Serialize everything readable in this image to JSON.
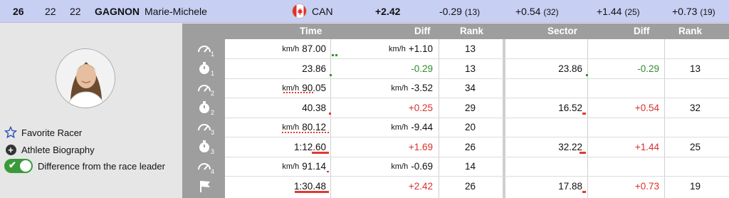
{
  "header": {
    "rank": "26",
    "num1": "22",
    "num2": "22",
    "last_name": "GAGNON",
    "first_name": "Marie-Michele",
    "nation": "CAN",
    "total_diff": "+2.42",
    "splits": [
      {
        "diff": "-0.29",
        "rank": "(13)"
      },
      {
        "diff": "+0.54",
        "rank": "(32)"
      },
      {
        "diff": "+1.44",
        "rank": "(25)"
      },
      {
        "diff": "+0.73",
        "rank": "(19)"
      }
    ]
  },
  "options": {
    "favorite": "Favorite Racer",
    "biography": "Athlete Biography",
    "difference": "Difference from the race leader",
    "difference_on": true
  },
  "columns": {
    "time": "Time",
    "diff": "Diff",
    "rank": "Rank",
    "sector": "Sector",
    "sector_diff": "Diff",
    "sector_rank": "Rank"
  },
  "rows": [
    {
      "icon": "speed-1-icon",
      "unit": "km/h",
      "time": "87.00",
      "diff_unit": "km/h",
      "diff": "+1.10",
      "rank": "13",
      "sector": "",
      "sector_diff": "",
      "sector_rank": ""
    },
    {
      "icon": "stopwatch-1-icon",
      "unit": "",
      "time": "23.86",
      "diff_unit": "",
      "diff": "-0.29",
      "rank": "13",
      "sector": "23.86",
      "sector_diff": "-0.29",
      "sector_rank": "13"
    },
    {
      "icon": "speed-2-icon",
      "unit": "km/h",
      "time": "90.05",
      "diff_unit": "km/h",
      "diff": "-3.52",
      "rank": "34",
      "sector": "",
      "sector_diff": "",
      "sector_rank": ""
    },
    {
      "icon": "stopwatch-2-icon",
      "unit": "",
      "time": "40.38",
      "diff_unit": "",
      "diff": "+0.25",
      "rank": "29",
      "sector": "16.52",
      "sector_diff": "+0.54",
      "sector_rank": "32"
    },
    {
      "icon": "speed-3-icon",
      "unit": "km/h",
      "time": "80.12",
      "diff_unit": "km/h",
      "diff": "-9.44",
      "rank": "20",
      "sector": "",
      "sector_diff": "",
      "sector_rank": ""
    },
    {
      "icon": "stopwatch-3-icon",
      "unit": "",
      "time": "1:12.60",
      "diff_unit": "",
      "diff": "+1.69",
      "rank": "26",
      "sector": "32.22",
      "sector_diff": "+1.44",
      "sector_rank": "25"
    },
    {
      "icon": "speed-4-icon",
      "unit": "km/h",
      "time": "91.14",
      "diff_unit": "km/h",
      "diff": "-0.69",
      "rank": "14",
      "sector": "",
      "sector_diff": "",
      "sector_rank": ""
    },
    {
      "icon": "finish-flag-icon",
      "unit": "",
      "time": "1:30.48",
      "diff_unit": "",
      "diff": "+2.42",
      "rank": "26",
      "sector": "17.88",
      "sector_diff": "+0.73",
      "sector_rank": "19"
    }
  ],
  "colors": {
    "header_bg": "#c7cff3",
    "negative": "#2e8b2e",
    "positive": "#d9302c"
  }
}
